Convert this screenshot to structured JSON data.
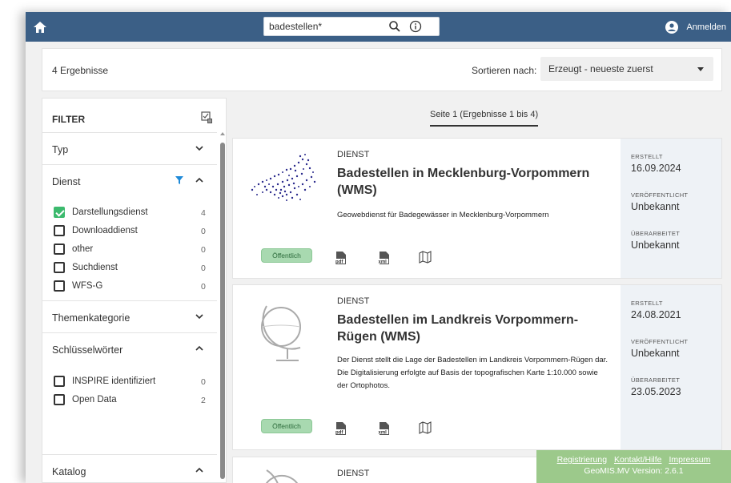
{
  "topbar": {
    "search_value": "badestellen*",
    "login_label": "Anmelden"
  },
  "results": {
    "count_label": "4 Ergebnisse",
    "sort_label": "Sortieren nach:",
    "sort_value": "Erzeugt - neueste zuerst"
  },
  "filter": {
    "title": "FILTER",
    "sections": [
      {
        "label": "Typ",
        "expanded": false
      },
      {
        "label": "Dienst",
        "expanded": true,
        "active_filter": true,
        "options": [
          {
            "label": "Darstellungsdienst",
            "count": "4",
            "checked": true
          },
          {
            "label": "Downloaddienst",
            "count": "0",
            "checked": false
          },
          {
            "label": "other",
            "count": "0",
            "checked": false
          },
          {
            "label": "Suchdienst",
            "count": "0",
            "checked": false
          },
          {
            "label": "WFS-G",
            "count": "0",
            "checked": false
          }
        ]
      },
      {
        "label": "Themenkategorie",
        "expanded": false
      },
      {
        "label": "Schlüsselwörter",
        "expanded": true,
        "options": [
          {
            "label": "INSPIRE identifiziert",
            "count": "0",
            "checked": false
          },
          {
            "label": "Open Data",
            "count": "2",
            "checked": false
          }
        ]
      },
      {
        "label": "Katalog",
        "expanded": true
      }
    ]
  },
  "pager": "Seite 1 (Ergebnisse 1 bis 4)",
  "cards": [
    {
      "type": "DIENST",
      "title": "Badestellen in Mecklenburg-Vorpommern (WMS)",
      "description": "Geowebdienst für Badegewässer in Mecklenburg-Vorpommern",
      "badge": "Öffentlich",
      "created_label": "ERSTELLT",
      "created": "16.09.2024",
      "published_label": "VERÖFFENTLICHT",
      "published": "Unbekannt",
      "revised_label": "ÜBERARBEITET",
      "revised": "Unbekannt"
    },
    {
      "type": "DIENST",
      "title": "Badestellen im Landkreis Vorpommern-Rügen (WMS)",
      "description": "Der Dienst stellt die Lage der Badestellen im Landkreis Vorpommern-Rügen dar. Die Digitalisierung erfolgte auf Basis der topografischen Karte 1:10.000 sowie der Ortophotos.",
      "badge": "Öffentlich",
      "created_label": "ERSTELLT",
      "created": "24.08.2021",
      "published_label": "VERÖFFENTLICHT",
      "published": "Unbekannt",
      "revised_label": "ÜBERARBEITET",
      "revised": "23.05.2023"
    },
    {
      "type": "DIENST"
    }
  ],
  "footer": {
    "links": [
      "Registrierung",
      "Kontakt/Hilfe",
      "Impressum"
    ],
    "version": "GeoMIS.MV Version: 2.6.1"
  },
  "colors": {
    "topbar": "#3b5f86",
    "accent_green": "#3cba6e",
    "badge": "#a8d9b0",
    "footer": "#9cc98b",
    "side_panel": "#eef2f6"
  }
}
